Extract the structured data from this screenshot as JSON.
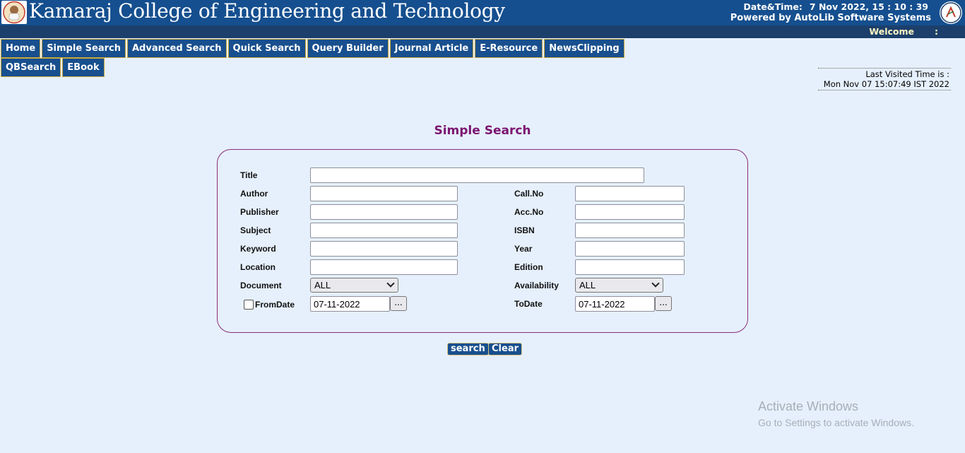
{
  "header": {
    "college_name": "Kamaraj College of Engineering and Technology",
    "datetime_label": "Date&Time:",
    "datetime_value": "7 Nov 2022, 15 : 10 : 39",
    "powered_by": "Powered by AutoLib Software Systems",
    "welcome": "Welcome",
    "welcome_colon": ":"
  },
  "nav": {
    "row1": [
      "Home",
      "Simple Search",
      "Advanced Search",
      "Quick Search",
      "Query Builder",
      "Journal Article",
      "E-Resource",
      "NewsClipping"
    ],
    "row2": [
      "QBSearch",
      "EBook"
    ]
  },
  "last_visited": {
    "label": "Last Visited Time is :",
    "value": "Mon Nov 07 15:07:49 IST 2022"
  },
  "page_title": "Simple Search",
  "form": {
    "title_label": "Title",
    "author_label": "Author",
    "publisher_label": "Publisher",
    "subject_label": "Subject",
    "keyword_label": "Keyword",
    "location_label": "Location",
    "document_label": "Document",
    "document_value": "ALL",
    "fromdate_label": "FromDate",
    "fromdate_value": "07-11-2022",
    "callno_label": "Call.No",
    "accno_label": "Acc.No",
    "isbn_label": "ISBN",
    "year_label": "Year",
    "edition_label": "Edition",
    "availability_label": "Availability",
    "availability_value": "ALL",
    "todate_label": "ToDate",
    "todate_value": "07-11-2022",
    "date_picker_label": "..."
  },
  "actions": {
    "search": "search",
    "clear": "Clear"
  },
  "watermark": {
    "line1": "Activate Windows",
    "line2": "Go to Settings to activate Windows."
  }
}
